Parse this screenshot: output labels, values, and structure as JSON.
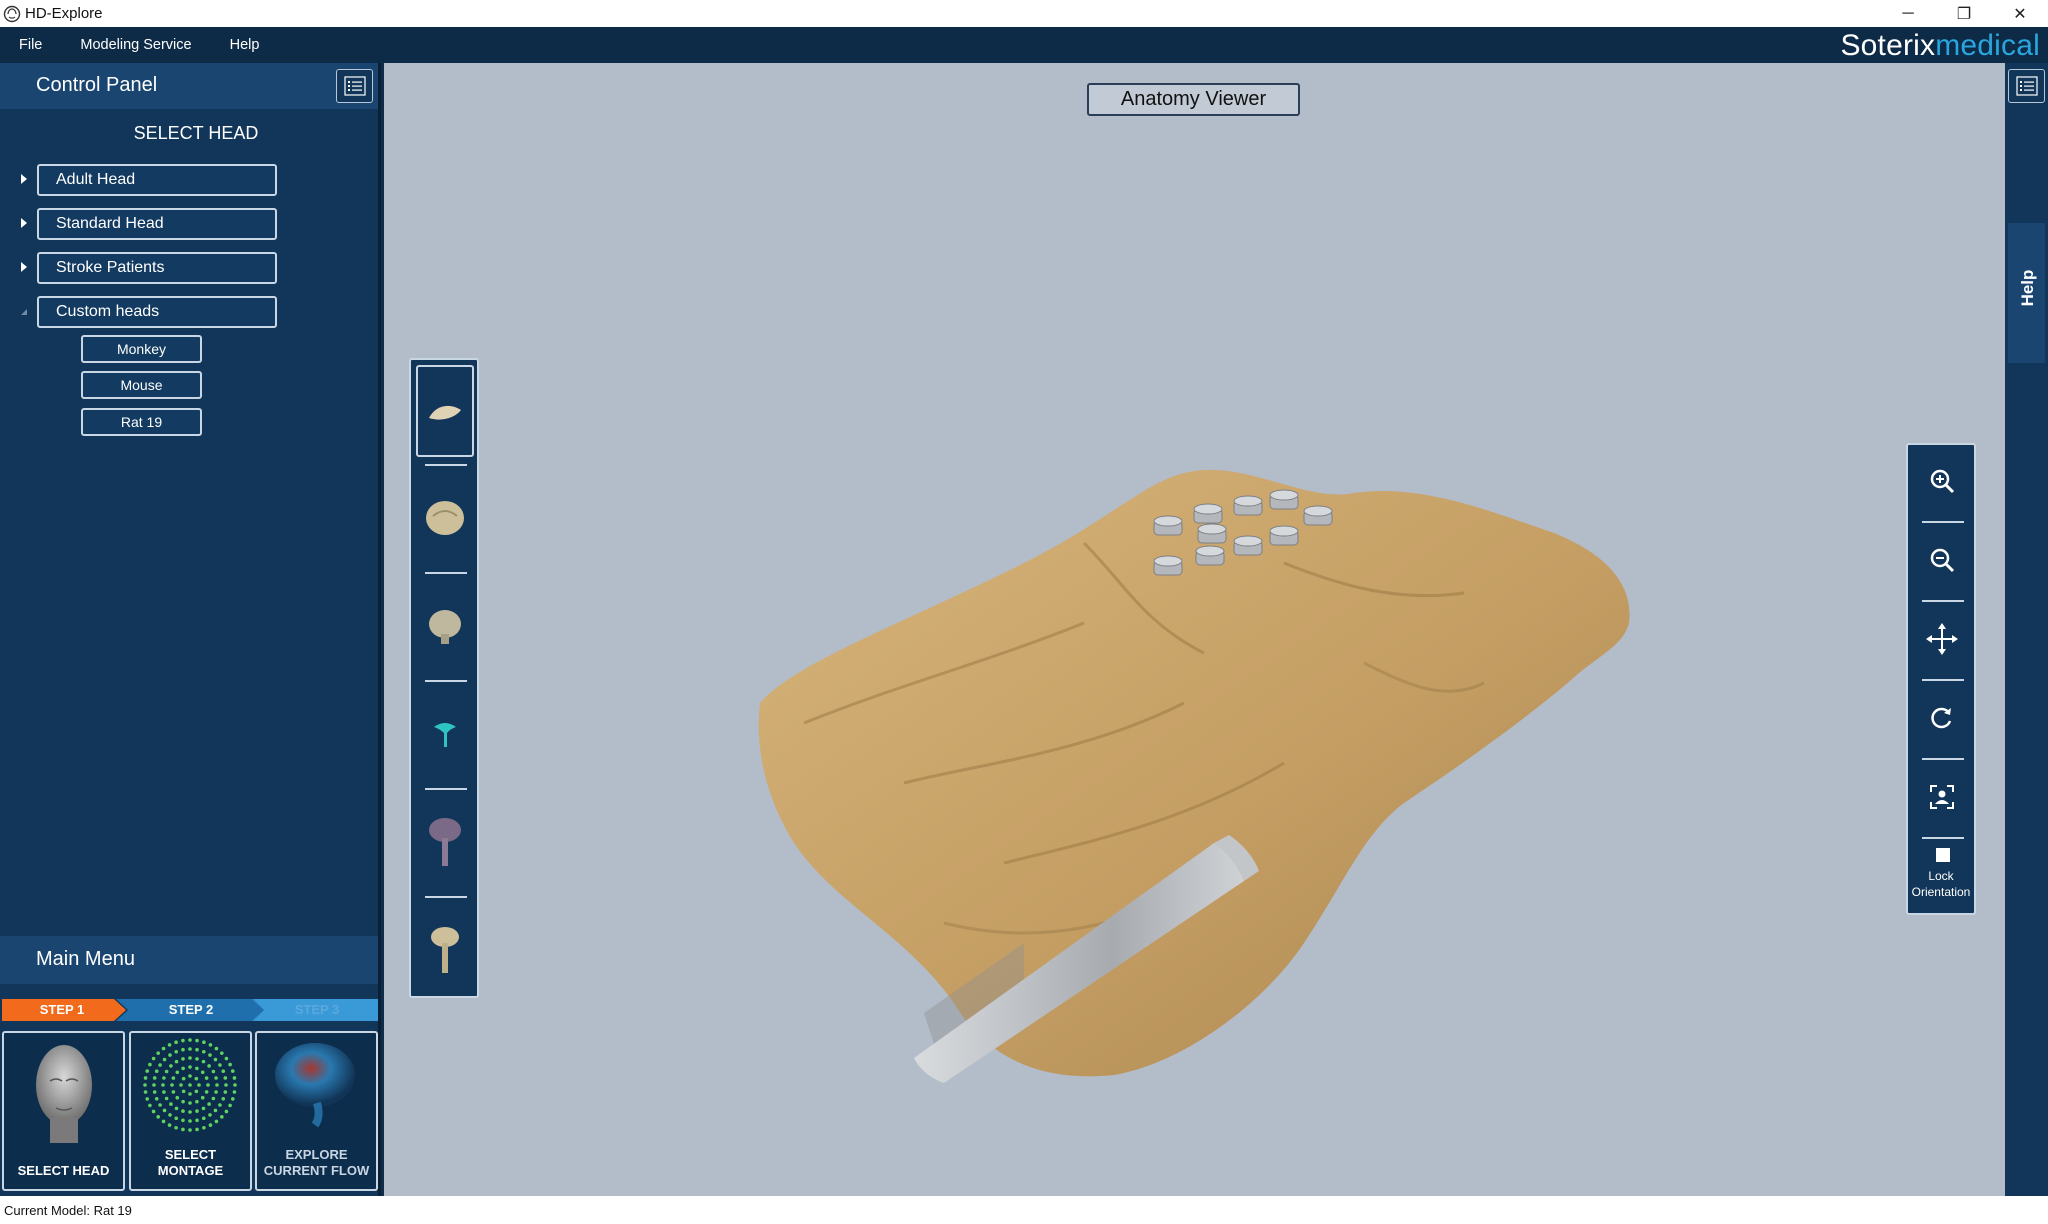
{
  "window": {
    "title": "HD-Explore",
    "controls": {
      "minimize": "─",
      "restore": "❐",
      "close": "✕"
    }
  },
  "menubar": {
    "items": [
      "File",
      "Modeling Service",
      "Help"
    ],
    "brand_part1": "Soterix",
    "brand_part2": "medical"
  },
  "control_panel": {
    "title": "Control Panel",
    "section_title": "SELECT HEAD",
    "groups": [
      {
        "label": "Adult Head",
        "expanded": false
      },
      {
        "label": "Standard Head",
        "expanded": false
      },
      {
        "label": "Stroke Patients",
        "expanded": false
      },
      {
        "label": "Custom heads",
        "expanded": true
      }
    ],
    "custom_heads": [
      "Monkey",
      "Mouse",
      "Rat 19"
    ]
  },
  "main_menu": {
    "title": "Main Menu",
    "steps": [
      "STEP 1",
      "STEP 2",
      "STEP 3"
    ],
    "cards": [
      {
        "caption": "SELECT HEAD"
      },
      {
        "caption_line1": "SELECT",
        "caption_line2": "MONTAGE"
      },
      {
        "caption_line1": "EXPLORE",
        "caption_line2": "CURRENT FLOW"
      }
    ]
  },
  "viewer": {
    "title": "Anatomy Viewer",
    "lock_label_line1": "Lock",
    "lock_label_line2": "Orientation"
  },
  "help_tab": {
    "label": "Help"
  },
  "status": {
    "text": "Current Model: Rat 19"
  },
  "colors": {
    "step_active": "#f26a1b",
    "step_next": "#1f6fad",
    "step_future": "#2f8fd0",
    "model_skin": "#c8a46b",
    "electrode": "#a9adb2"
  }
}
